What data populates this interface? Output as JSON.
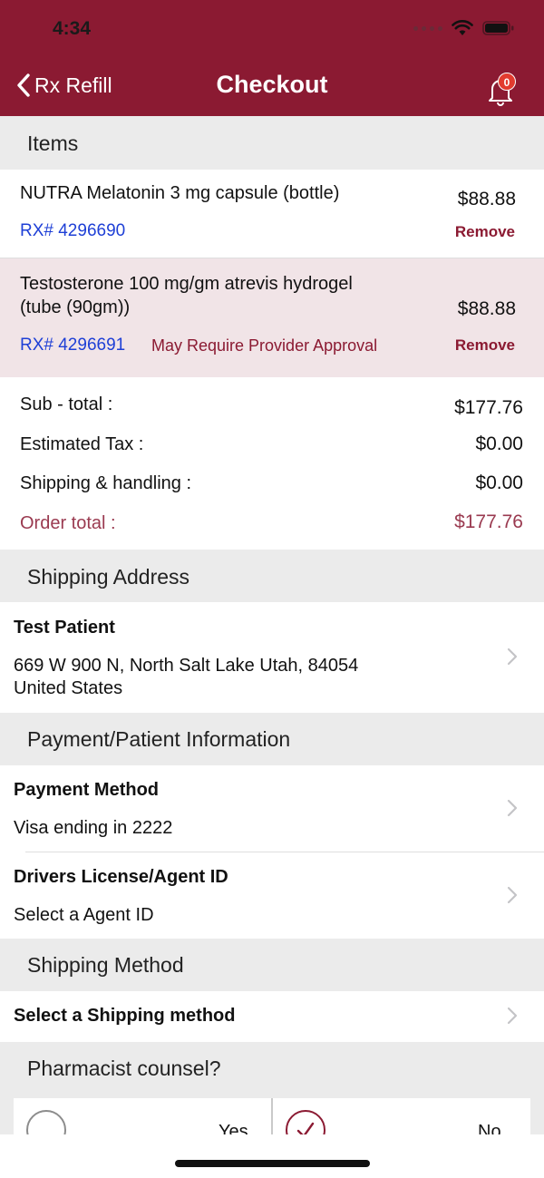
{
  "status": {
    "time": "4:34"
  },
  "nav": {
    "back_label": "Rx Refill",
    "title": "Checkout",
    "badge_count": "0"
  },
  "items_section": {
    "title": "Items"
  },
  "items": [
    {
      "name": "NUTRA Melatonin 3 mg capsule (bottle)",
      "rx": "RX# 4296690",
      "price": "$88.88",
      "remove_label": "Remove",
      "note": ""
    },
    {
      "name_line1": "Testosterone 100 mg/gm atrevis hydrogel",
      "name_line2": "(tube (90gm))",
      "rx": "RX# 4296691",
      "note": "May Require Provider Approval",
      "price": "$88.88",
      "remove_label": "Remove"
    }
  ],
  "totals": {
    "subtotal_label": "Sub - total :",
    "subtotal": "$177.76",
    "tax_label": "Estimated Tax :",
    "tax": "$0.00",
    "shipping_label": "Shipping & handling :",
    "shipping": "$0.00",
    "order_total_label": "Order total :",
    "order_total": "$177.76"
  },
  "shipping_address": {
    "section_title": "Shipping Address",
    "name": "Test Patient",
    "line1": "669 W 900 N, North Salt Lake Utah, 84054",
    "line2": "United States"
  },
  "payment": {
    "section_title": "Payment/Patient Information",
    "method_label": "Payment Method",
    "method_value": "Visa ending in 2222",
    "license_label": "Drivers License/Agent ID",
    "license_value": "Select a Agent ID"
  },
  "shipping_method": {
    "section_title": "Shipping Method",
    "value": "Select a Shipping method"
  },
  "counsel": {
    "section_title": "Pharmacist counsel?",
    "yes_label": "Yes",
    "no_label": "No",
    "selected": "No"
  },
  "colors": {
    "brand": "#8b1a32",
    "rx_link": "#1e3fd6",
    "section_bg": "#ebebeb",
    "highlight_row": "#f1e4e7",
    "badge": "#e23b2e"
  }
}
